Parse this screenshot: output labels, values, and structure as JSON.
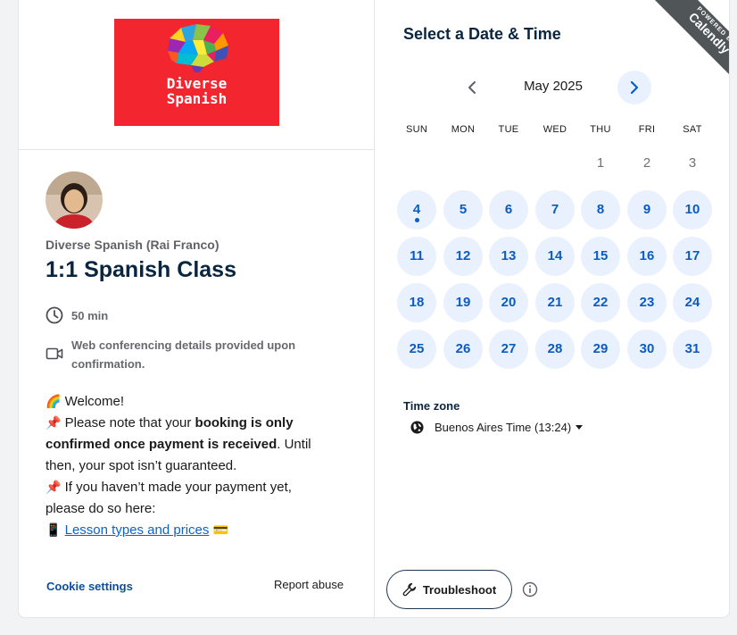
{
  "left": {
    "logo_text_line1": "Diverse",
    "logo_text_line2": "Spanish",
    "organizer": "Diverse Spanish (Rai Franco)",
    "event_title": "1:1 Spanish Class",
    "duration": "50 min",
    "location": "Web conferencing details provided upon confirmation.",
    "description": {
      "line1_emoji": "🌈",
      "line1_text": "Welcome!",
      "line2_emoji": "📌",
      "line2_pre": "Please note that your ",
      "line2_bold": "booking is only confirmed once payment is received",
      "line2_post": ". Until then, your spot isn’t guaranteed.",
      "line3_emoji": "📌",
      "line3_text": "If you haven’t made your payment yet, please do so here:",
      "line4_emoji_pre": "📱",
      "line4_link": "Lesson types and prices",
      "line4_emoji_post": "💳"
    },
    "cookie_settings": "Cookie settings",
    "report_abuse": "Report abuse"
  },
  "ribbon": {
    "small": "POWERED BY",
    "big": "Calendly"
  },
  "calendar": {
    "title": "Select a Date & Time",
    "month": "May 2025",
    "weekdays": [
      "SUN",
      "MON",
      "TUE",
      "WED",
      "THU",
      "FRI",
      "SAT"
    ],
    "unavailable_days": [
      "1",
      "2",
      "3"
    ],
    "available_days": [
      "4",
      "5",
      "6",
      "7",
      "8",
      "9",
      "10",
      "11",
      "12",
      "13",
      "14",
      "15",
      "16",
      "17",
      "18",
      "19",
      "20",
      "21",
      "22",
      "23",
      "24",
      "25",
      "26",
      "27",
      "28",
      "29",
      "30",
      "31"
    ],
    "today": "4",
    "accent_color": "#0b5cc2",
    "available_bg": "#e8f1fd"
  },
  "timezone": {
    "label": "Time zone",
    "value": "Buenos Aires Time (13:24)"
  },
  "footer": {
    "troubleshoot": "Troubleshoot",
    "info_icon": "info-icon"
  }
}
